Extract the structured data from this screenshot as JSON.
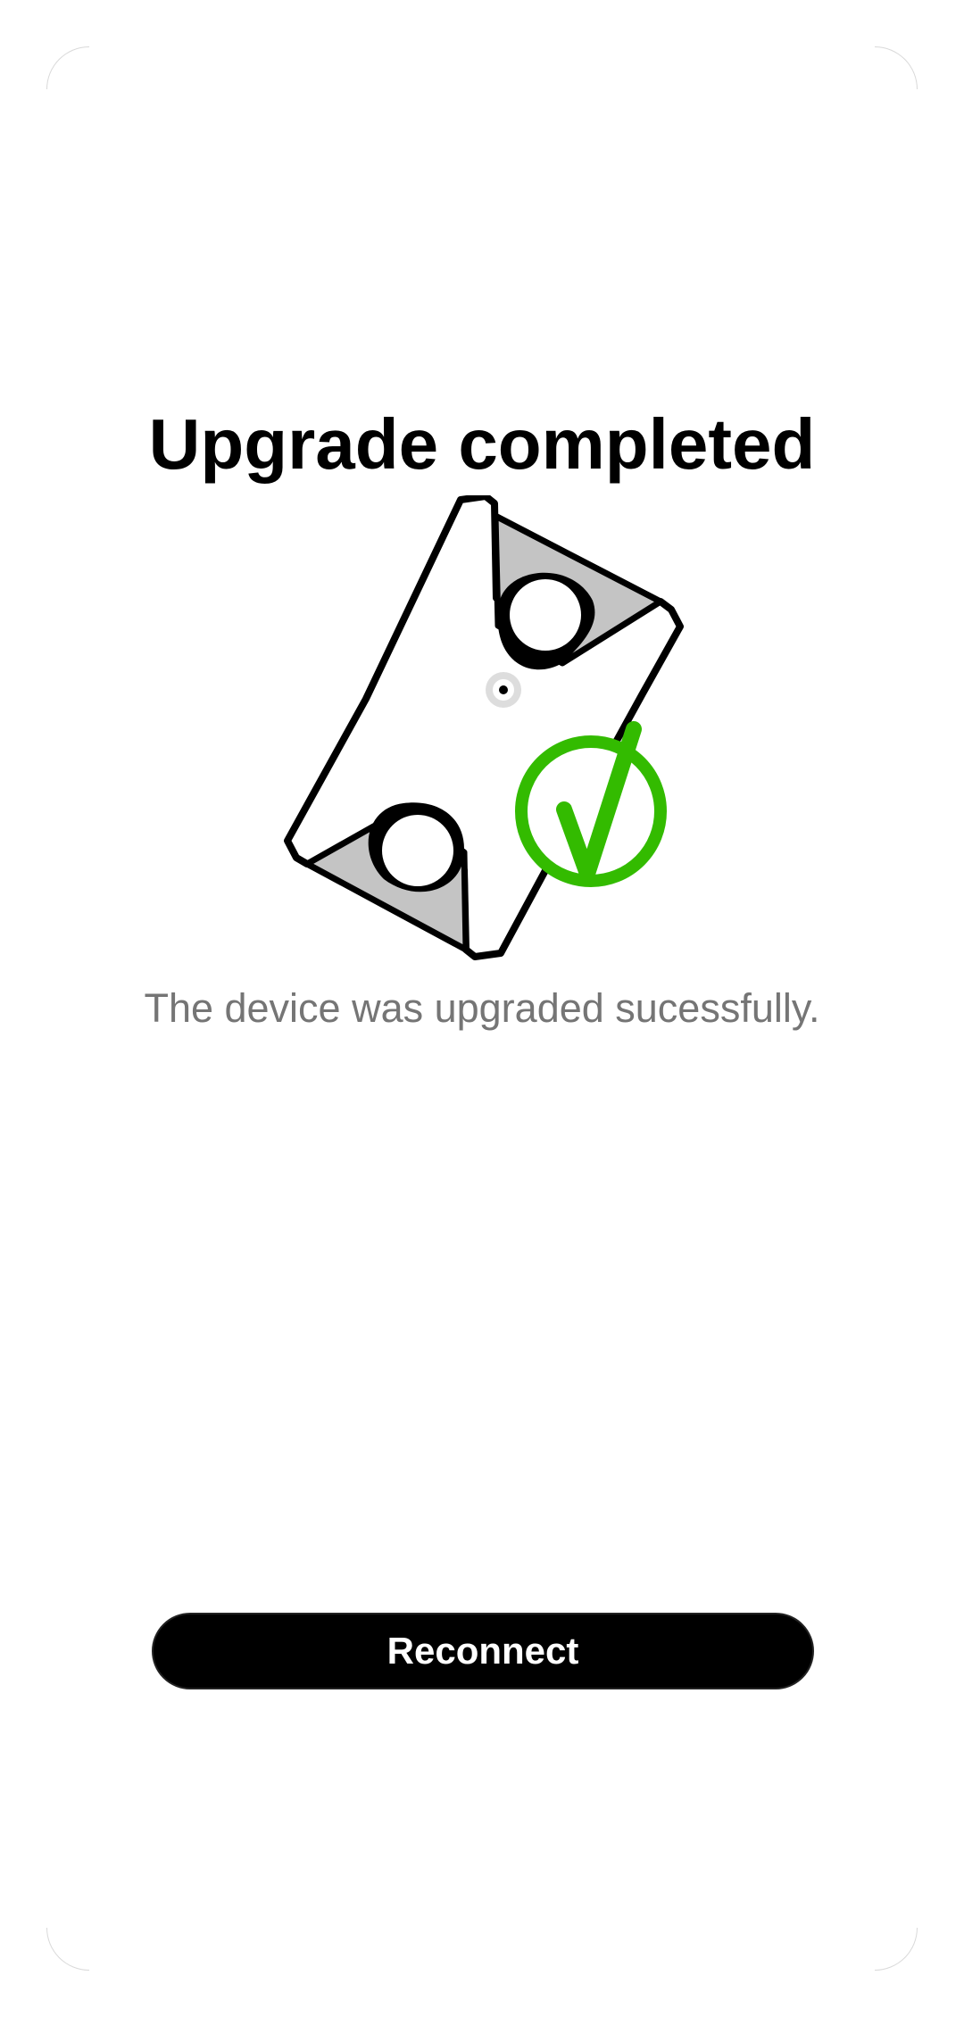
{
  "screen": {
    "title": "Upgrade completed",
    "message": "The device was upgraded sucessfully.",
    "reconnect_label": "Reconnect"
  },
  "illustration": {
    "device_icon": "device-illustration",
    "status_icon": "checkmark-circle-icon",
    "colors": {
      "success_green": "#33bb00",
      "outline": "#000000",
      "fill_gray": "#c4c4c4",
      "body": "#ffffff"
    }
  },
  "colors": {
    "background": "#ffffff",
    "title_text": "#000000",
    "message_text": "#757575",
    "button_background": "#000000",
    "button_text": "#ffffff"
  }
}
